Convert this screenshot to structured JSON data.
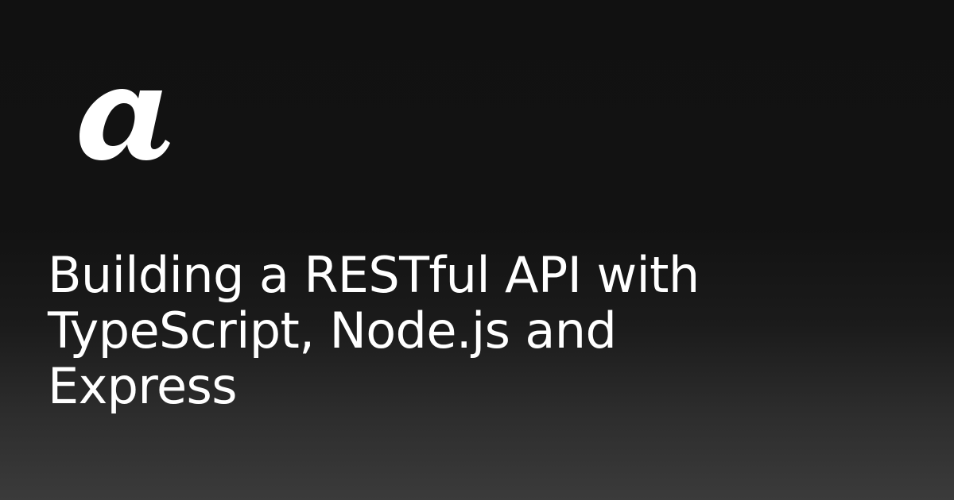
{
  "logo": {
    "text": "a",
    "icon": "stylized-letter-a-logo",
    "color": "#ffffff"
  },
  "title": {
    "lines": [
      "Building a RESTful API with",
      "TypeScript, Node.js and",
      "Express"
    ]
  },
  "colors": {
    "background_top": "#111111",
    "background_bottom": "#3b3b3b",
    "text": "#ffffff"
  }
}
